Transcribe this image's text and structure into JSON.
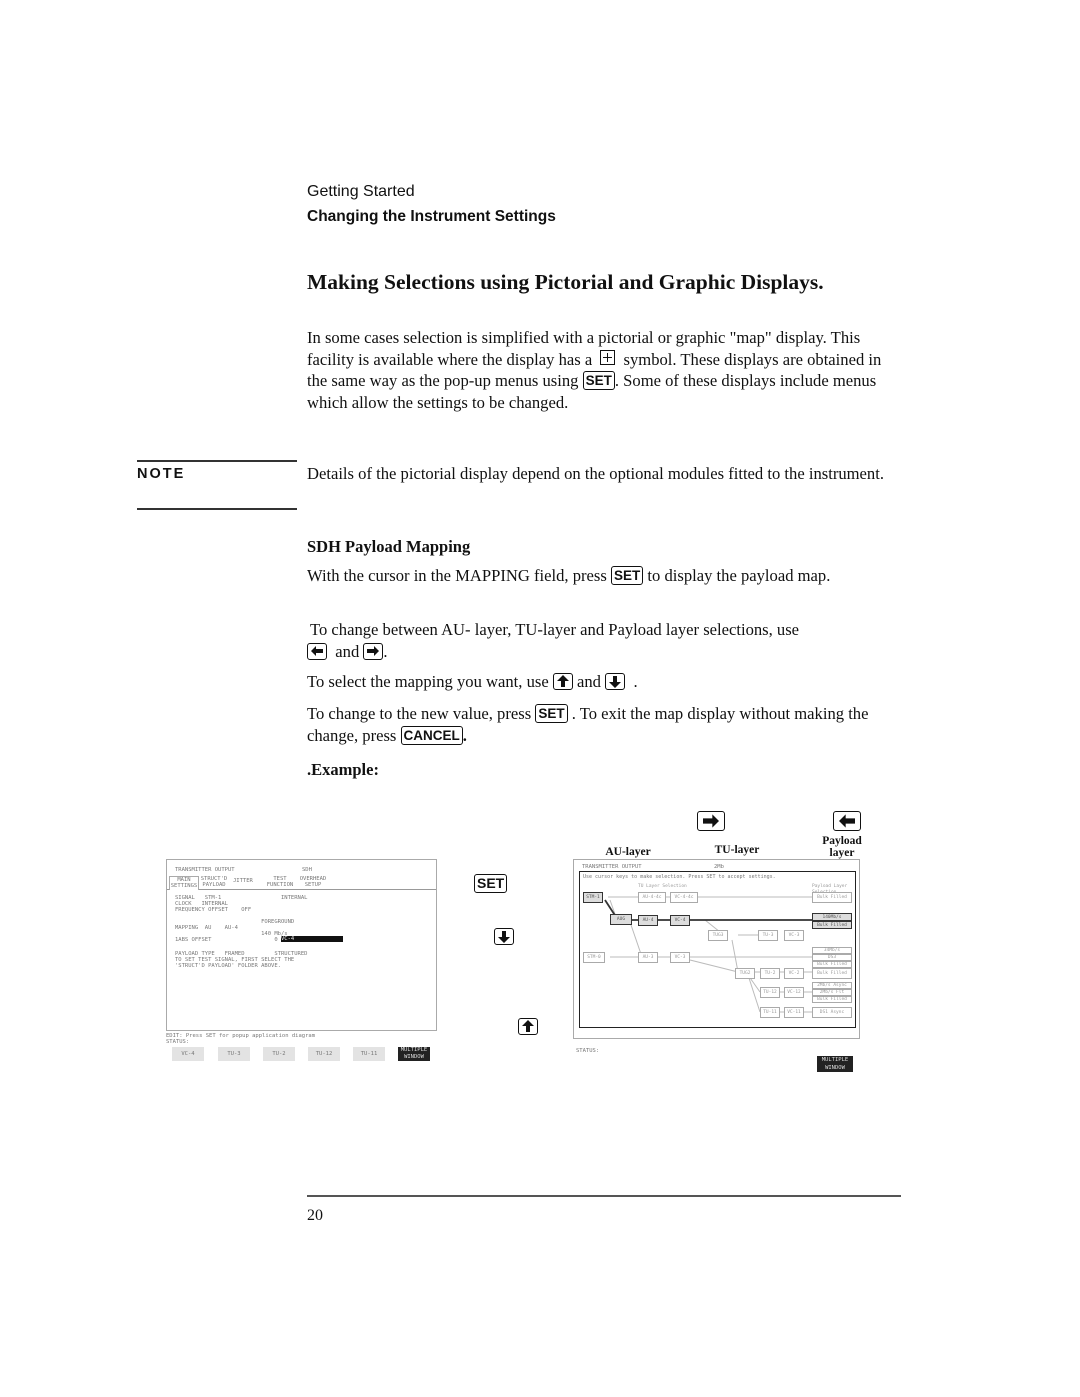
{
  "header": {
    "section": "Getting Started",
    "subsection": "Changing the Instrument Settings"
  },
  "heading": "Making Selections using Pictorial and Graphic Displays.",
  "intro": {
    "p1_a": "In some cases selection is simplified with a pictorial or graphic \"map\" display. This facility is available where the display has a",
    "p1_b": "symbol. These displays are obtained in the same way as the pop-up menus using",
    "p1_c": ". Some of these displays include menus which allow the settings to be changed.",
    "plus_symbol_icon": "boxed-plus-icon"
  },
  "note": {
    "label": "NOTE",
    "text": "Details of the pictorial display depend on the optional modules fitted to the instrument."
  },
  "sdh": {
    "heading": "SDH Payload Mapping",
    "p1_a": "With the cursor in the MAPPING field, press",
    "p1_b": "to display the payload map.",
    "p2_a": "To change between AU- layer, TU-layer and Payload layer selections, use",
    "p2_and": "and",
    "p2_end": ".",
    "p3_a": "To select the mapping you want, use",
    "p3_and": "and",
    "p3_end": ".",
    "p4_a": "To change to the new value, press",
    "p4_b": ". To exit the map display without making the change, press",
    "p4_end": ".",
    "example": ".Example:"
  },
  "keys": {
    "set": "SET",
    "cancel": "CANCEL"
  },
  "example": {
    "left_screen": {
      "title": "TRANSMITTER OUTPUT",
      "title_right": "SDH",
      "tabs": [
        "MAIN SETTINGS",
        "STRUCT'D PAYLOAD",
        "JITTER",
        "TEST FUNCTION",
        "OVERHEAD SETUP"
      ],
      "lines": [
        "SIGNAL   STM-1                  INTERNAL",
        "CLOCK   INTERNAL",
        "FREQUENCY OFFSET    OFF",
        "",
        "                          FOREGROUND",
        "MAPPING  AU    AU-4",
        "                          140 Mb/s",
        "1ABS OFFSET                   0 ppm",
        "",
        "PAYLOAD TYPE   FRAMED         STRUCTURED",
        "TO SET TEST SIGNAL, FIRST SELECT THE",
        "'STRUCT'D PAYLOAD' FOLDER ABOVE."
      ],
      "highlighted": "VC-4",
      "status_line": "EDIT: Press SET for popup application diagram",
      "status_label": "STATUS:",
      "softkeys": [
        "VC-4",
        "TU-3",
        "TU-2",
        "TU-12",
        "TU-11"
      ],
      "softkey_dark": "MULTIPLE WINDOW"
    },
    "middle_keys": {
      "set": "SET",
      "down_icon": "arrow-down-icon",
      "up_icon": "arrow-up-icon"
    },
    "top_keys": {
      "right_icon": "arrow-right-icon",
      "left_icon": "arrow-left-icon"
    },
    "layer_labels": [
      "AU-layer",
      "TU-layer",
      "Payload layer"
    ],
    "right_screen": {
      "title": "TRANSMITTER OUTPUT",
      "title_right": "2Mb",
      "instruction": "Use cursor keys to make selection. Press SET to accept settings.",
      "tu_header": "TU Layer Selection",
      "payload_header": "Payload Layer Selection",
      "nodes": {
        "row1": [
          "STM-1",
          "AU-4-4c",
          "VC-4-4c",
          "Bulk Filled"
        ],
        "row2": [
          "AUG",
          "AU-4",
          "VC-4",
          "140Mb/s",
          "Bulk Filled"
        ],
        "row3": [
          "TUG3",
          "TU-3",
          "VC-3"
        ],
        "row4": [
          "STM-0",
          "AU-3",
          "VC-3",
          "34Mb/s",
          "DS3",
          "Bulk Filled"
        ],
        "row5": [
          "TUG2",
          "TU-2",
          "VC-2",
          "Bulk Filled"
        ],
        "row6": [
          "TU-12",
          "VC-12",
          "2Mb/s Async",
          "2Mb/s Flt",
          "Bulk Filled"
        ],
        "row7": [
          "TU-11",
          "VC-11",
          "DS1 Async"
        ]
      },
      "status_label": "STATUS:",
      "softkey_dark": "MULTIPLE WINDOW"
    }
  },
  "footer": {
    "page_number": "20"
  }
}
